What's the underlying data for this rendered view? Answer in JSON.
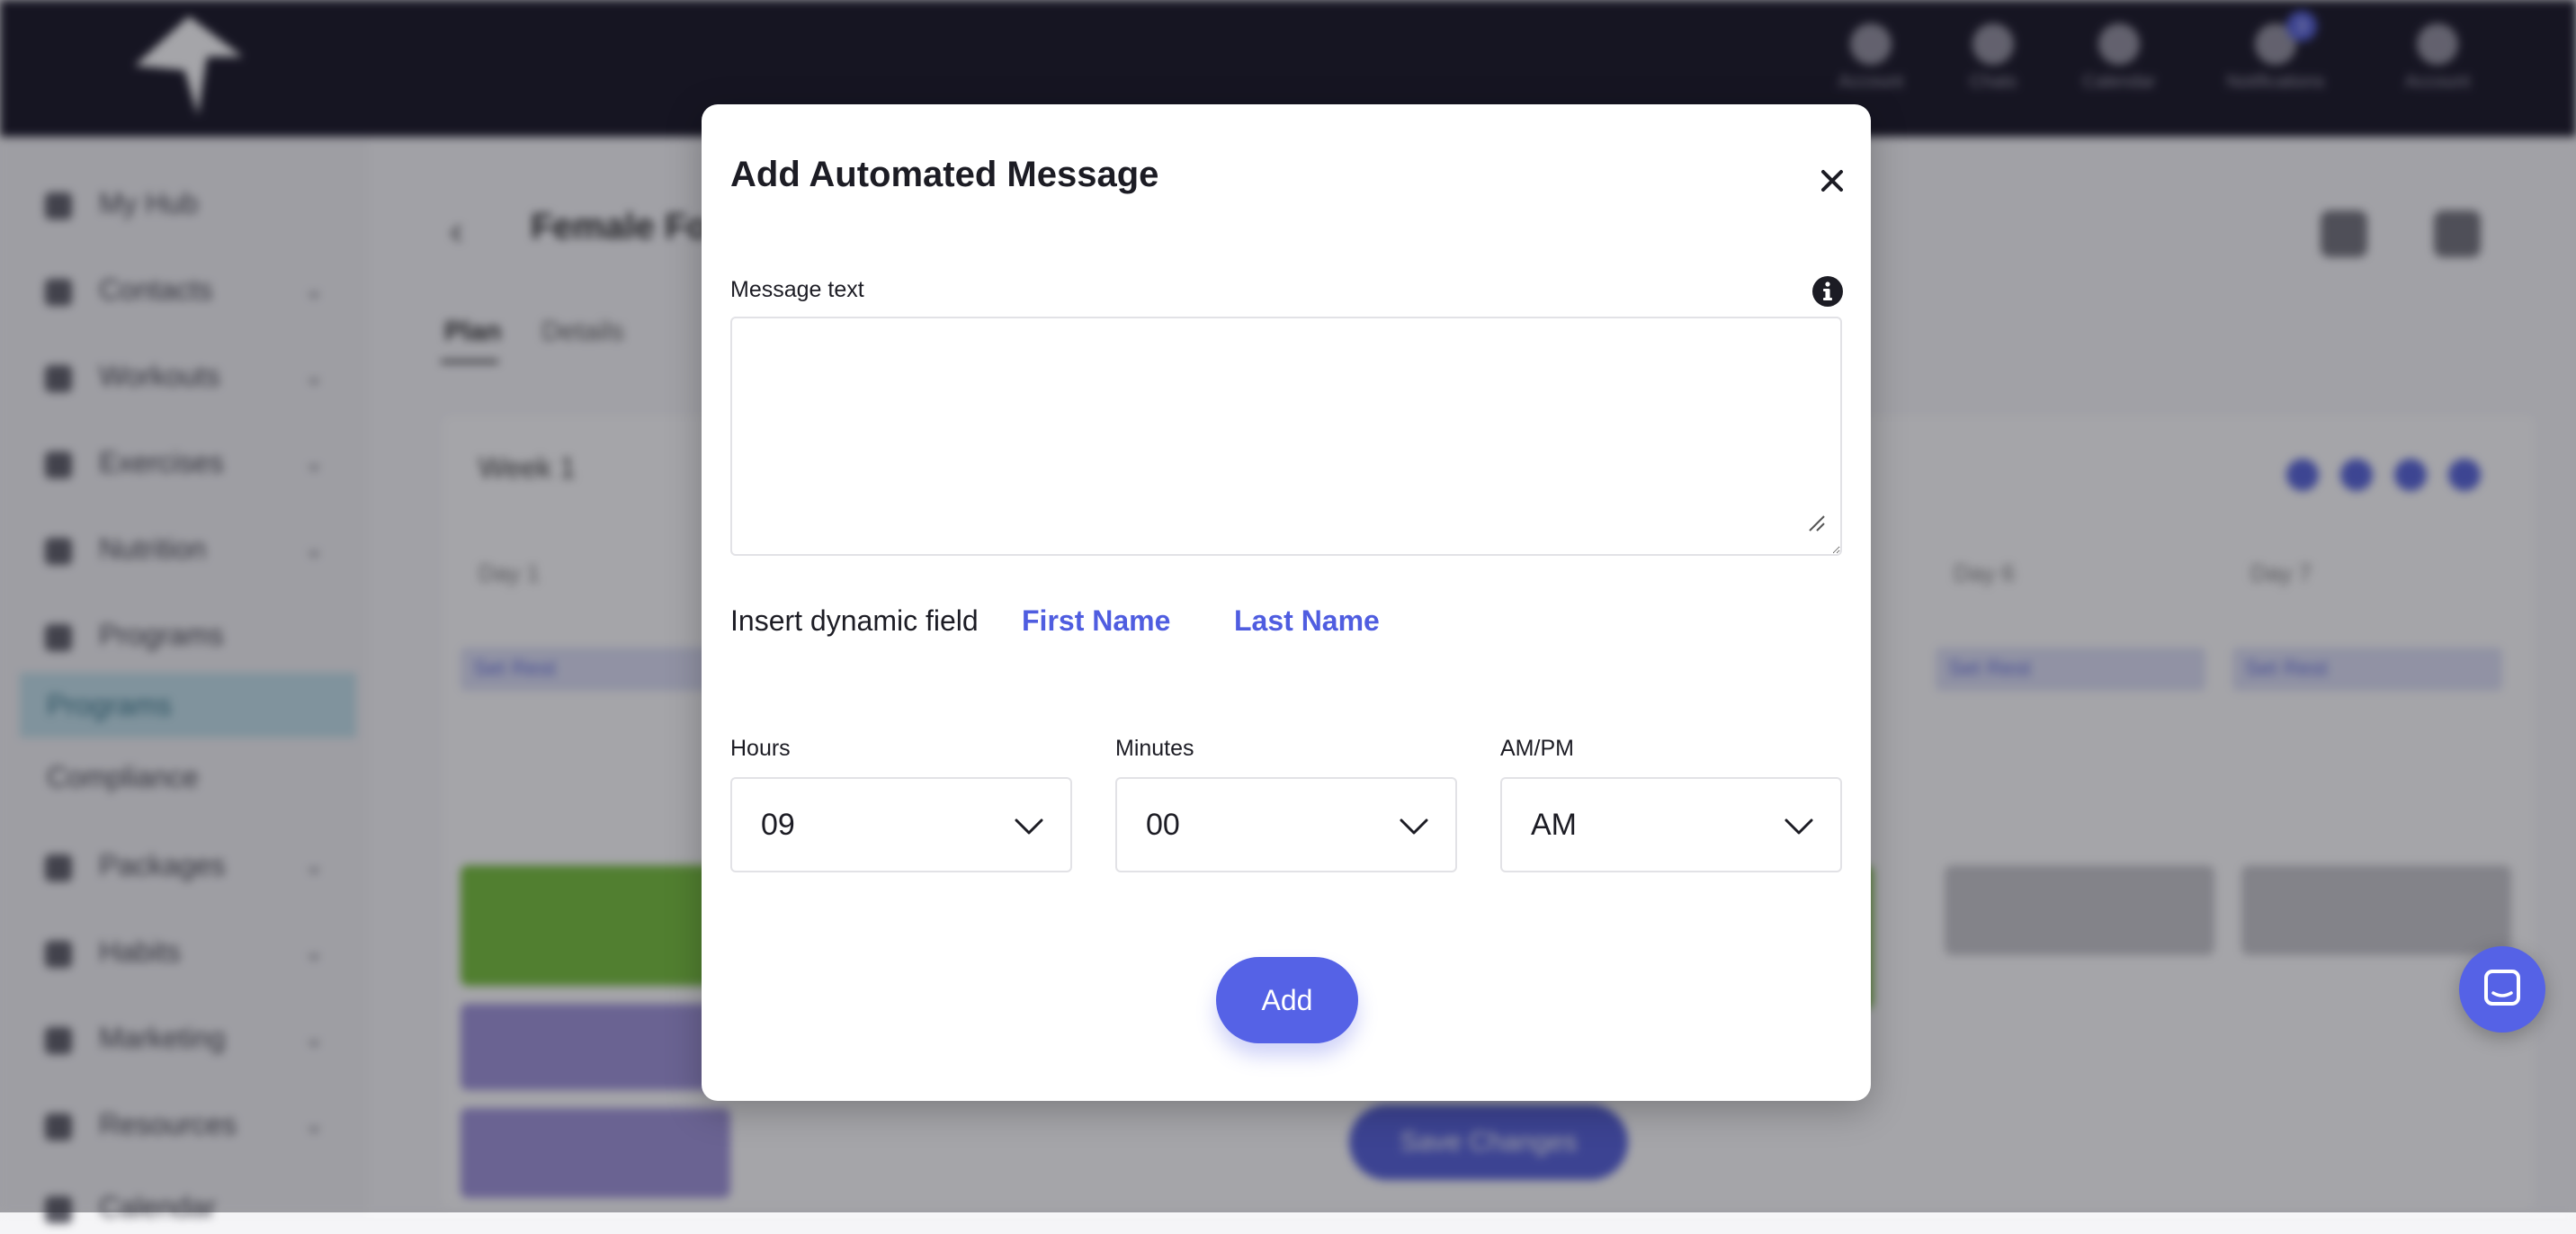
{
  "background": {
    "top_nav": [
      {
        "label": "Account",
        "icon": "person-icon"
      },
      {
        "label": "Chats",
        "icon": "chat-icon"
      },
      {
        "label": "Calendar",
        "icon": "clock-icon"
      },
      {
        "label": "Notifications",
        "icon": "bell-icon",
        "badge": "3"
      },
      {
        "label": "Account",
        "icon": "briefcase-icon"
      }
    ],
    "sidebar": {
      "items": [
        {
          "label": "My Hub"
        },
        {
          "label": "Contacts"
        },
        {
          "label": "Workouts"
        },
        {
          "label": "Exercises"
        },
        {
          "label": "Nutrition"
        },
        {
          "label": "Programs"
        }
      ],
      "sub_items": [
        {
          "label": "Programs"
        },
        {
          "label": "Compliance"
        }
      ],
      "lower_items": [
        {
          "label": "Packages"
        },
        {
          "label": "Habits"
        },
        {
          "label": "Marketing"
        },
        {
          "label": "Resources"
        },
        {
          "label": "Calendar"
        }
      ]
    },
    "program_title": "Female Fo",
    "tabs": [
      {
        "label": "Plan"
      },
      {
        "label": "Details"
      }
    ],
    "week_label": "Week 1",
    "days": [
      "Day 1",
      "Day 6",
      "Day 7"
    ],
    "day_chip": "Set Rest",
    "bottom_button": "Save Changes"
  },
  "modal": {
    "title": "Add Automated Message",
    "message_text_label": "Message text",
    "message_text_value": "",
    "message_text_placeholder": "",
    "dynamic_field_label": "Insert dynamic field",
    "dynamic_fields": [
      {
        "label": "First Name"
      },
      {
        "label": "Last Name"
      }
    ],
    "hours": {
      "label": "Hours",
      "value": "09"
    },
    "minutes": {
      "label": "Minutes",
      "value": "00"
    },
    "ampm": {
      "label": "AM/PM",
      "value": "AM"
    },
    "add_button": "Add"
  },
  "colors": {
    "accent": "#5562e6",
    "link": "#4f5de0",
    "topbar": "#0a0818"
  }
}
